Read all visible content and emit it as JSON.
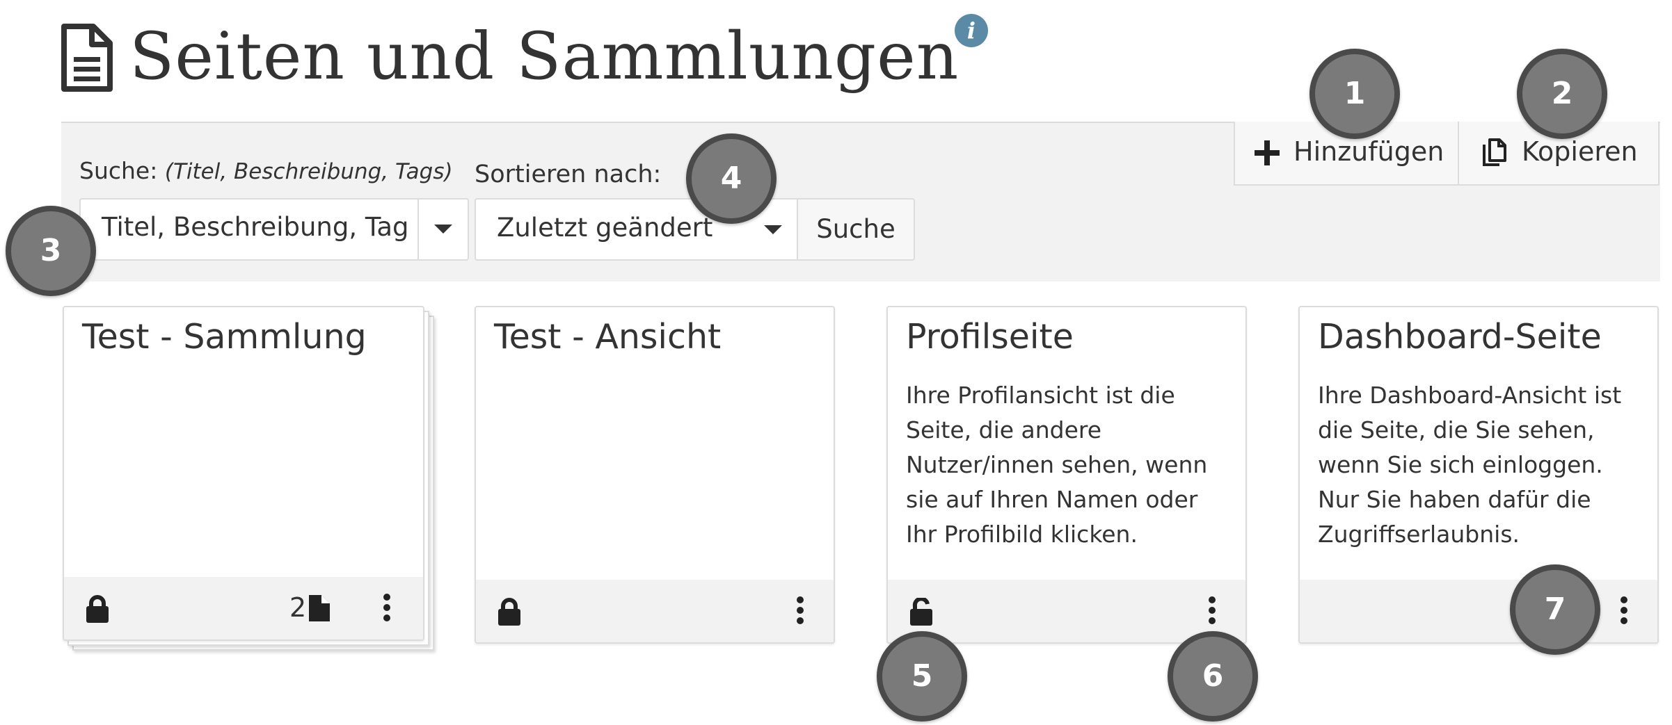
{
  "header": {
    "title": "Seiten und Sammlungen",
    "info_glyph": "i"
  },
  "toolbar": {
    "search_label": "Suche:",
    "search_hint": "(Titel, Beschreibung, Tags)",
    "search_value": "Titel, Beschreibung, Tag",
    "sort_label": "Sortieren nach:",
    "sort_value": "Zuletzt geändert",
    "search_button": "Suche",
    "add_button": "Hinzufügen",
    "copy_button": "Kopieren"
  },
  "cards": [
    {
      "title": "Test - Sammlung",
      "description": "",
      "locked": true,
      "page_count": "2"
    },
    {
      "title": "Test - Ansicht",
      "description": "",
      "locked": true
    },
    {
      "title": "Profilseite",
      "description": "Ihre Profilansicht ist die Seite, die andere Nutzer/innen sehen, wenn sie auf Ihren Namen oder Ihr Profilbild klicken.",
      "locked": false
    },
    {
      "title": "Dashboard-Seite",
      "description": "Ihre Dashboard-Ansicht ist die Seite, die Sie sehen, wenn Sie sich einloggen. Nur Sie haben dafür die Zugriffserlaubnis.",
      "locked": null
    }
  ],
  "callouts": [
    "1",
    "2",
    "3",
    "4",
    "5",
    "6",
    "7"
  ],
  "colors": {
    "toolbar_bg": "#f2f2f2",
    "border": "#dcdcdc",
    "info_icon": "#5b8aa6",
    "callout_fill": "#7a7a7a",
    "callout_ring": "#4a4a4a"
  },
  "icons": [
    "file-icon",
    "info-icon",
    "caret-down-icon",
    "plus-icon",
    "copy-icon",
    "lock-icon",
    "unlock-icon",
    "page-icon",
    "kebab-icon"
  ]
}
